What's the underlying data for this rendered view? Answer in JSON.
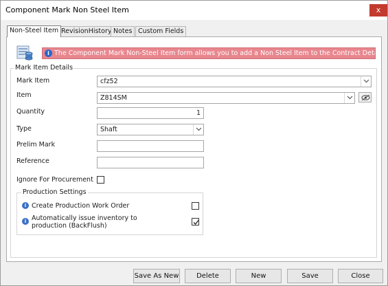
{
  "window": {
    "title": "Component Mark Non Steel Item",
    "close_glyph": "x"
  },
  "tabs": [
    {
      "label": "Non-Steel Item",
      "active": true
    },
    {
      "label": "RevisionHistory",
      "active": false
    },
    {
      "label": "Notes",
      "active": false
    },
    {
      "label": "Custom Fields",
      "active": false
    }
  ],
  "info": {
    "icon": "info-icon",
    "message": "The Component Mark Non-Steel Item form allows you to add a Non Steel Item to the Contract Detailed Listing.",
    "color": "#e8868e"
  },
  "details": {
    "group_title": "Mark Item Details",
    "mark_item": {
      "label": "Mark Item",
      "value": "cfz52"
    },
    "item": {
      "label": "Item",
      "value": "Z814SM"
    },
    "quantity": {
      "label": "Quantity",
      "value": "1"
    },
    "type": {
      "label": "Type",
      "value": "Shaft"
    },
    "prelim_mark": {
      "label": "Prelim Mark",
      "value": ""
    },
    "reference": {
      "label": "Reference",
      "value": ""
    },
    "ignore_procurement": {
      "label": "Ignore For Procurement",
      "checked": false
    }
  },
  "production": {
    "group_title": "Production Settings",
    "create_work_order": {
      "label": "Create Production Work Order",
      "checked": false
    },
    "auto_issue": {
      "label": "Automatically issue inventory to production (BackFlush)",
      "checked": true
    }
  },
  "buttons": {
    "save_as_new": "Save As New",
    "delete": "Delete",
    "new": "New",
    "save": "Save",
    "close": "Close"
  }
}
